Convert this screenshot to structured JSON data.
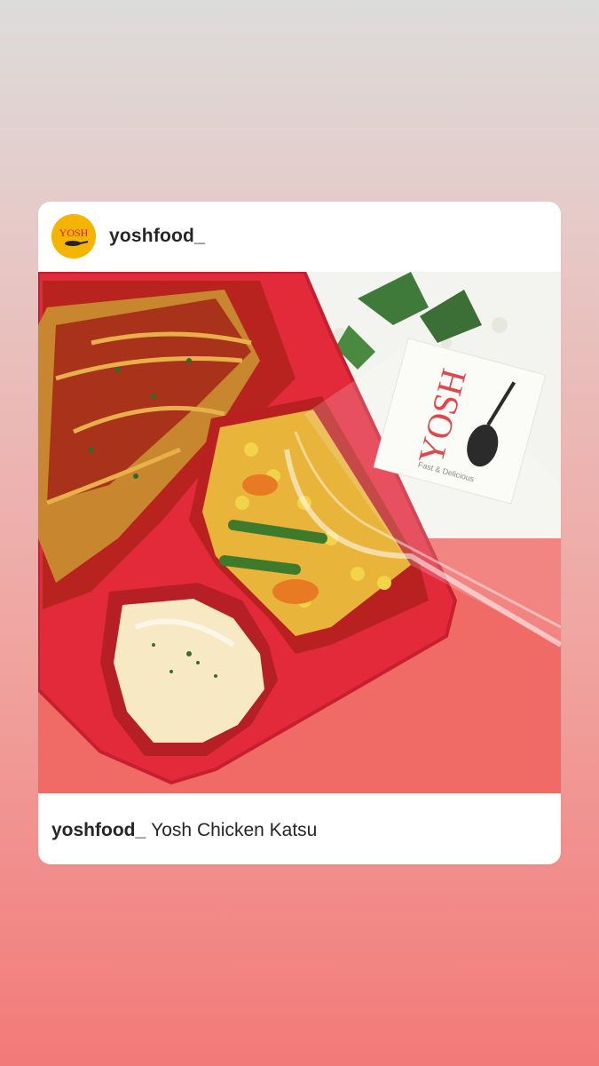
{
  "post": {
    "username": "yoshfood_",
    "avatar_text": "YOSH",
    "caption": {
      "username": "yoshfood_",
      "text": "Yosh Chicken Katsu"
    },
    "photo": {
      "card_logo_text": "YOSH",
      "card_logo_subtext": "Fast & Delicious"
    }
  },
  "colors": {
    "avatar_bg": "#f5b400",
    "tray_red": "#e8283c",
    "background_top": "#dcdcdb",
    "background_bottom": "#f27a78"
  }
}
